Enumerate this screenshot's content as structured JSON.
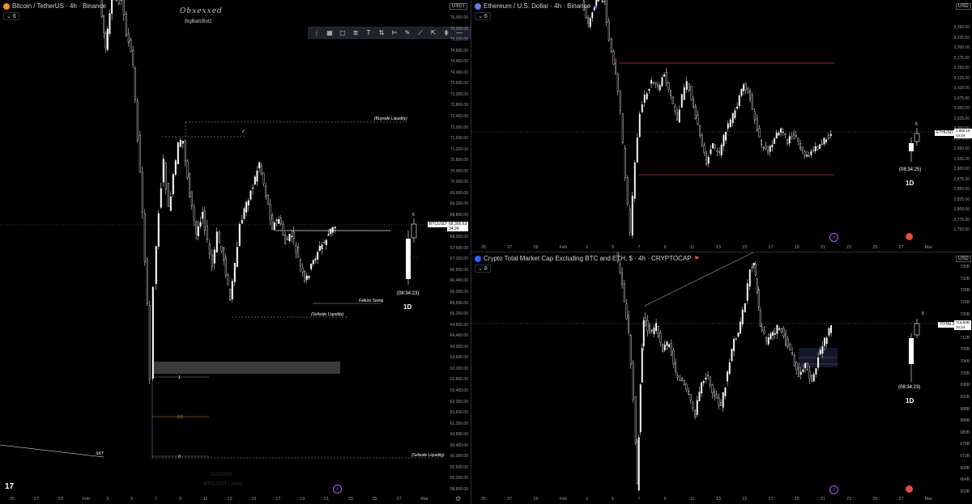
{
  "btc": {
    "title": "Bitcoin / TetherUS · 4h · Binance",
    "interval_badge": "6",
    "currency": "USDT",
    "brand": "Obxexxed",
    "brand_sub": "BigBallzBotz",
    "price_tag_symbol": "BTCUSDT",
    "price_tag_value": "68,305.63",
    "price_tag_time": "34:24",
    "timer": "(08:34:23)",
    "timeframe": "1D",
    "candle_number": "5",
    "label_buyside": "(Buyside Liquidity)",
    "label_sellside_mid": "(Sellside Liquidity)",
    "label_sellside_low": "(Sellside Liquidity)",
    "label_failure": "Failure Swing",
    "label_skt": "SKT",
    "fib_1": "1",
    "fib_05": "0.5",
    "fib_0": "0",
    "watermark_date": "21/2/2026",
    "watermark_pair": "BTCUSDT / 240m",
    "x_ticks": [
      "25",
      "27",
      "29",
      "Feb",
      "3",
      "5",
      "7",
      "9",
      "11",
      "13",
      "15",
      "17",
      "19",
      "21",
      "23",
      "25",
      "27",
      "Mar"
    ],
    "y_ticks": [
      "76,000.00",
      "75,600.00",
      "75,200.00",
      "74,800.00",
      "74,400.00",
      "74,000.00",
      "73,600.00",
      "73,200.00",
      "72,800.00",
      "72,400.00",
      "72,000.00",
      "71,600.00",
      "71,200.00",
      "70,800.00",
      "70,400.00",
      "70,000.00",
      "69,600.00",
      "69,200.00",
      "68,800.00",
      "68,400.00",
      "68,000.00",
      "67,600.00",
      "67,200.00",
      "66,800.00",
      "66,400.00",
      "66,000.00",
      "65,600.00",
      "65,200.00",
      "64,800.00",
      "64,400.00",
      "64,000.00",
      "63,600.00",
      "63,200.00",
      "62,800.00",
      "62,400.00",
      "62,000.00",
      "61,600.00",
      "61,200.00",
      "60,800.00",
      "60,400.00",
      "60,000.00",
      "59,600.00",
      "59,200.00",
      "58,800.00"
    ]
  },
  "eth": {
    "title": "Ethereum / U.S. Dollar · 4h · Binance",
    "interval_badge": "6",
    "currency": "USD",
    "price_tag_symbol": "ETHUSD",
    "price_tag_value": "1,990.19",
    "price_tag_time": "34:24",
    "timer": "(08:34:25)",
    "timeframe": "1D",
    "candle_number": "5",
    "x_ticks": [
      "25",
      "27",
      "29",
      "Feb",
      "3",
      "5",
      "7",
      "9",
      "11",
      "13",
      "15",
      "17",
      "19",
      "21",
      "23",
      "25",
      "27",
      "Mar"
    ],
    "y_ticks": [
      "3,250.00",
      "3,225.00",
      "3,200.00",
      "3,175.00",
      "3,150.00",
      "3,125.00",
      "3,100.00",
      "3,075.00",
      "3,050.00",
      "3,025.00",
      "3,000.00",
      "2,975.00",
      "2,950.00",
      "2,925.00",
      "2,900.00",
      "2,875.00",
      "2,850.00",
      "2,825.00",
      "2,800.00",
      "2,775.00",
      "1,750.00"
    ]
  },
  "others": {
    "title": "Crypto Total Market Cap Excluding BTC and ETH, $ · 4h · CRYPTOCAP",
    "interval_badge": "6",
    "currency": "USD",
    "price_tag_symbol": "TOTAL3",
    "price_tag_value": "716.54B",
    "price_tag_time": "34:24",
    "timer": "(08:34:23)",
    "timeframe": "1D",
    "candle_number": "5",
    "x_ticks": [
      "25",
      "27",
      "29",
      "Feb",
      "3",
      "5",
      "7",
      "9",
      "11",
      "13",
      "15",
      "17",
      "19",
      "21",
      "23",
      "25",
      "27",
      "Mar"
    ],
    "y_ticks": [
      "736B",
      "732B",
      "728B",
      "724B",
      "720B",
      "716B",
      "712B",
      "708B",
      "704B",
      "700B",
      "696B",
      "692B",
      "688B",
      "684B",
      "680B",
      "676B",
      "672B",
      "668B",
      "664B",
      "660B"
    ]
  },
  "toolbar": {
    "icons": [
      "drag-handle-icon",
      "grid-icon",
      "rectangle-icon",
      "text-lines-icon",
      "text-icon",
      "brush-icon",
      "fib-icon",
      "pencil-icon",
      "ruler-icon",
      "measure-icon",
      "bars-icon",
      "more-icon"
    ]
  },
  "colors": {
    "bg": "#000000",
    "candle": "#ffffff",
    "grid": "#111111",
    "accent_red": "#c0392b",
    "tv_purple": "#b45cff"
  }
}
